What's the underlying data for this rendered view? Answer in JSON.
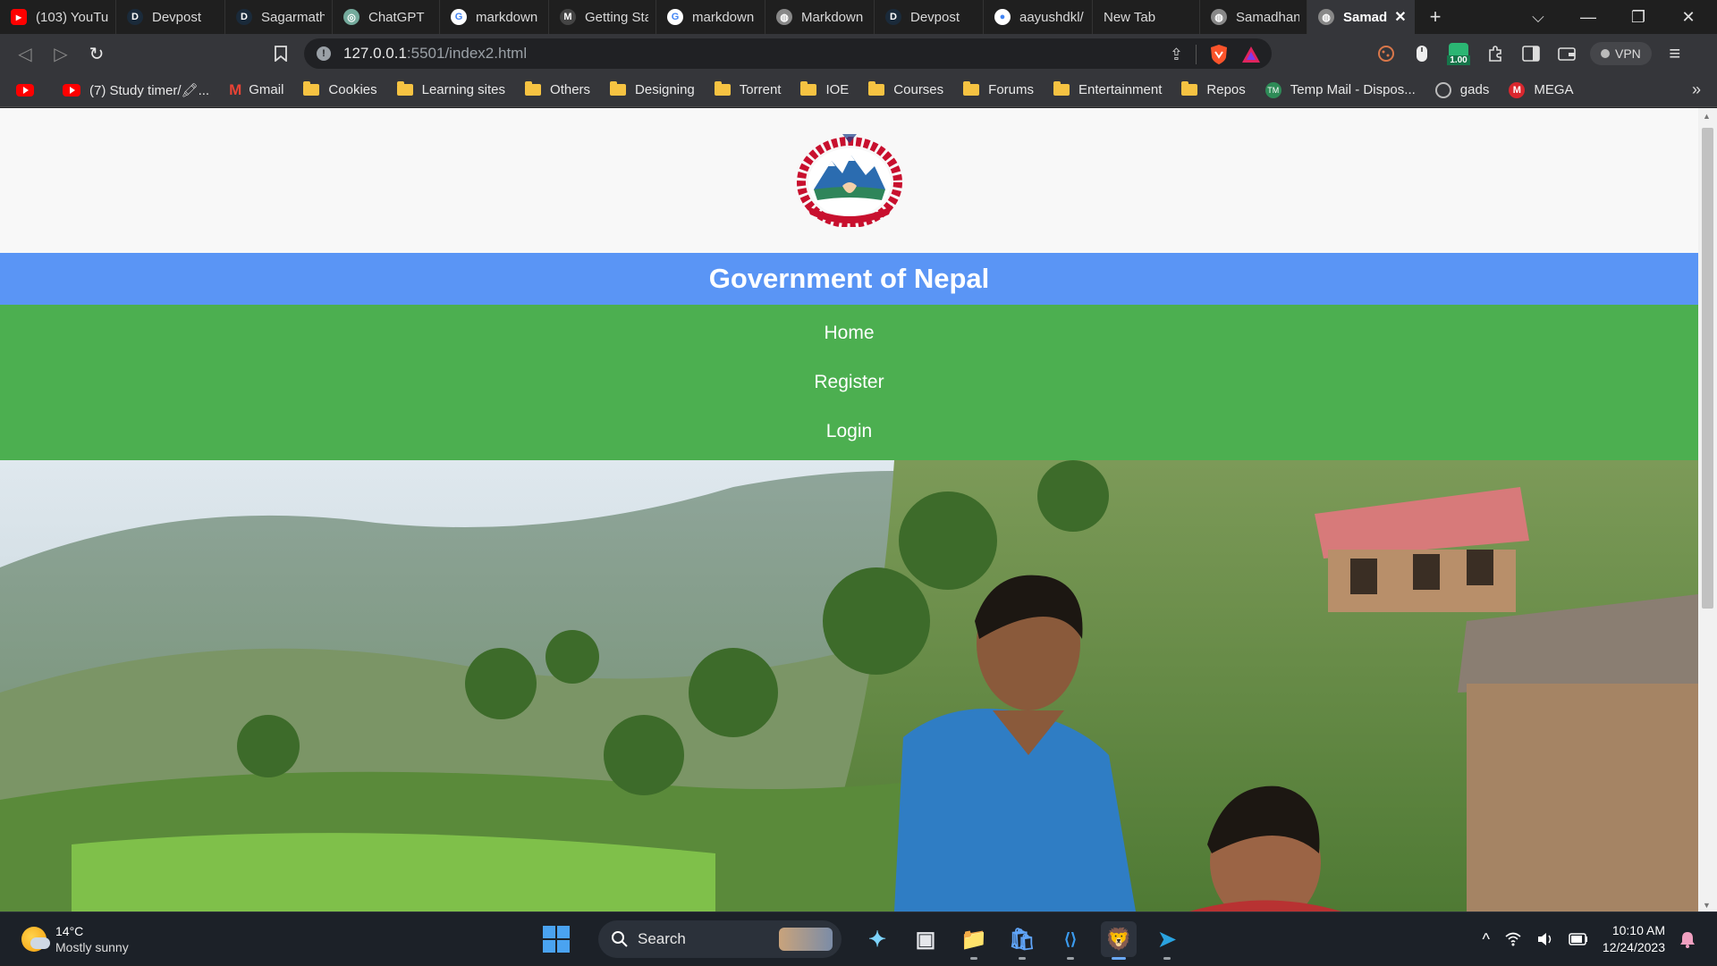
{
  "browser": {
    "tabs": [
      {
        "title": "(103) YouTu",
        "icon": "youtube-icon",
        "color": "#ff0000",
        "glyph": "▶"
      },
      {
        "title": "Devpost",
        "icon": "devpost-icon",
        "color": "#1a2a3a",
        "glyph": "D"
      },
      {
        "title": "Sagarmatha",
        "icon": "devpost-icon",
        "color": "#1a2a3a",
        "glyph": "D"
      },
      {
        "title": "ChatGPT",
        "icon": "chatgpt-icon",
        "color": "#74aa9c",
        "glyph": "◎"
      },
      {
        "title": "markdown",
        "icon": "google-icon",
        "color": "#ffffff",
        "glyph": "G"
      },
      {
        "title": "Getting Sta",
        "icon": "markdown-icon",
        "color": "#444444",
        "glyph": "M"
      },
      {
        "title": "markdown",
        "icon": "google-icon",
        "color": "#ffffff",
        "glyph": "G"
      },
      {
        "title": "Markdown",
        "icon": "globe-icon",
        "color": "#888888",
        "glyph": "◍"
      },
      {
        "title": "Devpost",
        "icon": "devpost-icon",
        "color": "#1a2a3a",
        "glyph": "D"
      },
      {
        "title": "aayushdkl/",
        "icon": "github-icon",
        "color": "#ffffff",
        "glyph": "●"
      },
      {
        "title": "New Tab",
        "icon": "",
        "color": "",
        "glyph": ""
      },
      {
        "title": "Samadhan",
        "icon": "globe-icon",
        "color": "#888888",
        "glyph": "◍"
      },
      {
        "title": "Samad",
        "icon": "globe-icon",
        "color": "#888888",
        "glyph": "◍"
      }
    ],
    "new_tab": "+",
    "tab_close": "✕",
    "window_controls": {
      "tab_search": "⌵",
      "minimize": "—",
      "restore": "❐",
      "close": "✕"
    },
    "nav": {
      "back": "◁",
      "forward": "▷",
      "reload": "↻",
      "bookmark": "🔖"
    },
    "url_host": "127.0.0.1",
    "url_rest": ":5501/index2.html",
    "share": "⇪",
    "extension_badge": "1.00",
    "vpn": "VPN",
    "menu": "≡"
  },
  "bookmarks": [
    {
      "label": "",
      "icon": "youtube-icon"
    },
    {
      "label": "(7) Study timer/🖍...",
      "icon": "youtube-icon"
    },
    {
      "label": "Gmail",
      "icon": "gmail-icon"
    },
    {
      "label": "Cookies",
      "icon": "folder-icon"
    },
    {
      "label": "Learning sites",
      "icon": "folder-icon"
    },
    {
      "label": "Others",
      "icon": "folder-icon"
    },
    {
      "label": "Designing",
      "icon": "folder-icon"
    },
    {
      "label": "Torrent",
      "icon": "folder-icon"
    },
    {
      "label": "IOE",
      "icon": "folder-icon"
    },
    {
      "label": "Courses",
      "icon": "folder-icon"
    },
    {
      "label": "Forums",
      "icon": "folder-icon"
    },
    {
      "label": "Entertainment",
      "icon": "folder-icon"
    },
    {
      "label": "Repos",
      "icon": "folder-icon"
    },
    {
      "label": "Temp Mail - Dispos...",
      "icon": "tempmail-icon"
    },
    {
      "label": "gads",
      "icon": "globe-icon"
    },
    {
      "label": "MEGA",
      "icon": "mega-icon"
    }
  ],
  "bookmarks_more": "»",
  "page": {
    "header": "Government of Nepal",
    "nav": [
      "Home",
      "Register",
      "Login"
    ]
  },
  "taskbar": {
    "temperature": "14°C",
    "weather": "Mostly sunny",
    "search": "Search",
    "apps": [
      {
        "name": "copilot-icon",
        "glyph": "✦",
        "active": false
      },
      {
        "name": "task-view-icon",
        "glyph": "▣",
        "active": false
      },
      {
        "name": "file-explorer-icon",
        "glyph": "📁",
        "active": false
      },
      {
        "name": "microsoft-store-icon",
        "glyph": "🛍",
        "active": false
      },
      {
        "name": "vscode-icon",
        "glyph": "⟨⟩",
        "active": false
      },
      {
        "name": "brave-icon",
        "glyph": "🦁",
        "active": true
      },
      {
        "name": "telegram-icon",
        "glyph": "➤",
        "active": false
      }
    ],
    "tray_chevron": "^",
    "time": "10:10 AM",
    "date": "12/24/2023"
  }
}
